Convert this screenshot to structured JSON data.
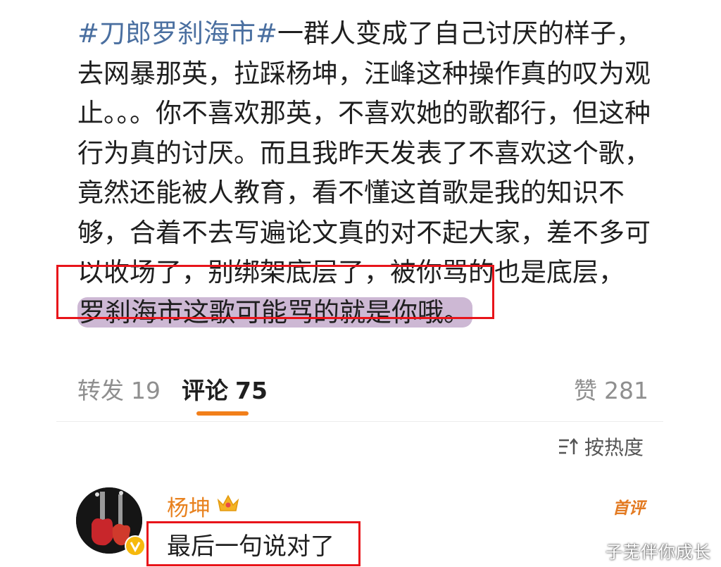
{
  "post": {
    "hashtag": "#刀郎罗刹海市#",
    "body": "一群人变成了自己讨厌的样子，去网暴那英，拉踩杨坤，汪峰这种操作真的叹为观止。。。你不喜欢那英，不喜欢她的歌都行，但这种行为真的讨厌。而且我昨天发表了不喜欢这个歌，竟然还能被人教育，看不懂这首歌是我的知识不够，合着不去写遍论文真的对不起大家，差不多可以收场了，别绑架底层了，被你骂的也是底层，",
    "highlighted": "罗刹海市这歌可能骂的就是你哦。"
  },
  "tabs": [
    {
      "label": "转发",
      "count": "19"
    },
    {
      "label": "评论",
      "count": "75"
    },
    {
      "label": "赞",
      "count": "281"
    }
  ],
  "sort": {
    "label": "按热度",
    "icon": "sort-icon"
  },
  "comment": {
    "username": "杨坤",
    "badge": "首评",
    "text": "最后一句说对了",
    "crown_icon": "crown-icon",
    "verified_icon": "verified-icon"
  },
  "watermark": "子芜伴你成长",
  "colors": {
    "hashtag": "#4a6fa0",
    "highlight": "#cdb8d4",
    "annotation_box": "#e8141a",
    "accent": "#f27f1a",
    "username": "#e8811e"
  }
}
